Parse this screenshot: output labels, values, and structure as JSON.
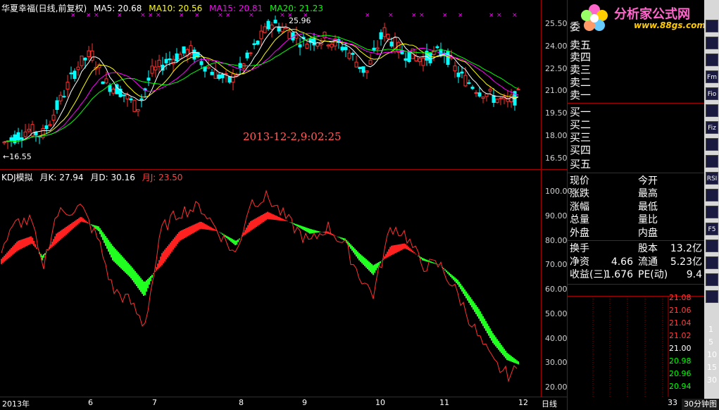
{
  "main_chart": {
    "title": "华夏幸福(日线,前复权)",
    "ma": [
      {
        "label": "MA5: 20.68",
        "color": "#ffffff"
      },
      {
        "label": "MA10: 20.56",
        "color": "#ffff00"
      },
      {
        "label": "MA15: 20.81",
        "color": "#ff00ff"
      },
      {
        "label": "MA20: 21.23",
        "color": "#00ff00"
      }
    ],
    "high_label": "25.96",
    "low_label": "←16.55",
    "timestamp": "2013-12-2,9:02:25",
    "y_ticks": [
      "25.50",
      "24.00",
      "22.50",
      "21.00",
      "19.50",
      "18.00",
      "16.50"
    ],
    "colors": {
      "up": "#ff3030",
      "down": "#00ffff",
      "ma5": "#ffffff",
      "ma10": "#ffff00",
      "ma15": "#ff00ff",
      "ma20": "#00ff00"
    }
  },
  "kdj": {
    "title": "KDJ模拟",
    "k_label": "月K: 27.94",
    "d_label": "月D: 30.16",
    "j_label": "月J: 23.50",
    "y_ticks": [
      "100.00",
      "90.00",
      "80.00",
      "70.00",
      "60.00",
      "50.00",
      "40.00",
      "30.00",
      "20.00"
    ]
  },
  "x_axis": {
    "labels": [
      "2013年",
      "6",
      "7",
      "8",
      "9",
      "10",
      "11",
      "12"
    ],
    "period": "日线"
  },
  "order_book": {
    "top_clipped": "委",
    "sell": [
      "卖五",
      "卖四",
      "卖三",
      "卖二",
      "卖一"
    ],
    "buy": [
      "买一",
      "买二",
      "买三",
      "买四",
      "买五"
    ]
  },
  "quote": {
    "rows": [
      {
        "l1": "现价",
        "v1": "",
        "l2": "今开",
        "v2": ""
      },
      {
        "l1": "涨跌",
        "v1": "",
        "l2": "最高",
        "v2": ""
      },
      {
        "l1": "涨幅",
        "v1": "",
        "l2": "最低",
        "v2": ""
      },
      {
        "l1": "总量",
        "v1": "",
        "l2": "量比",
        "v2": ""
      },
      {
        "l1": "外盘",
        "v1": "",
        "l2": "内盘",
        "v2": ""
      }
    ],
    "rows2": [
      {
        "l1": "换手",
        "v1": "",
        "l2": "股本",
        "v2": "13.2亿"
      },
      {
        "l1": "净资",
        "v1": "4.66",
        "l2": "流通",
        "v2": "5.23亿"
      },
      {
        "l1": "收益(三)",
        "v1": "1.676",
        "l2": "PE(动)",
        "v2": "9.4"
      }
    ]
  },
  "tick_chart": {
    "y_ticks": [
      "21.08",
      "21.06",
      "21.04",
      "21.02",
      "21.00",
      "20.98",
      "20.96",
      "20.94"
    ],
    "x_ticks": [
      "1",
      "5",
      "10",
      "15",
      "30",
      "33"
    ],
    "tab_label": "30分钟图"
  },
  "watermark": {
    "brand": "分析家公式网",
    "url": "www.88gs.com"
  },
  "toolbar": [
    "",
    "",
    "",
    "Fm",
    "Fio",
    "",
    "Fiz",
    "",
    "",
    "RSI",
    "",
    "",
    "F5",
    "",
    "",
    "",
    ""
  ]
}
